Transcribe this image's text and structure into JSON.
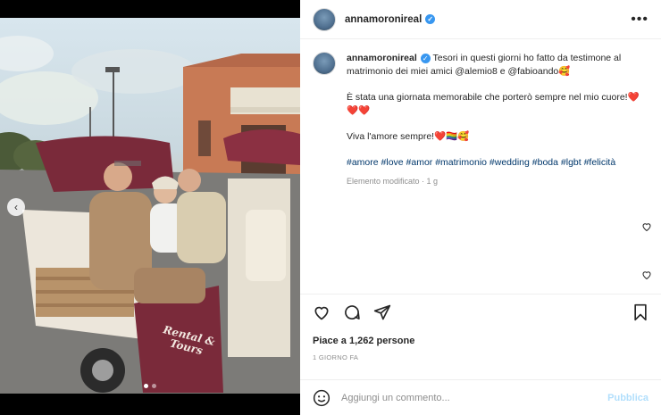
{
  "post": {
    "username": "annamoronireal",
    "more_icon": "more-horizontal-icon",
    "caption": {
      "username": "annamoronireal",
      "line1": "Tesori in questi giorni ho fatto da testimone al matrimonio dei miei amici @alemio8 e @fabioando🥰",
      "line2": "È stata una giornata memorabile che porterò sempre nel mio cuore!❤️❤️❤️",
      "line3": "Viva l'amore sempre!❤️🏳️‍🌈🥰",
      "hashtags": "#amore #love #amor #matrimonio #wedding #boda #lgbt #felicità",
      "edited": "Elemento modificato · 1 g"
    },
    "likes": "Piace a 1,262 persone",
    "time": "1 GIORNO FA",
    "comment_placeholder": "Aggiungi un commento...",
    "publish_label": "Pubblica"
  },
  "media": {
    "photo_text": "Rental & Tours",
    "carousel_count": 2,
    "carousel_index": 0
  },
  "colors": {
    "accent": "#3897f0",
    "publish_disabled": "#b2dffc",
    "hashtag": "#00376b",
    "cart_maroon": "#7a2a3a"
  }
}
